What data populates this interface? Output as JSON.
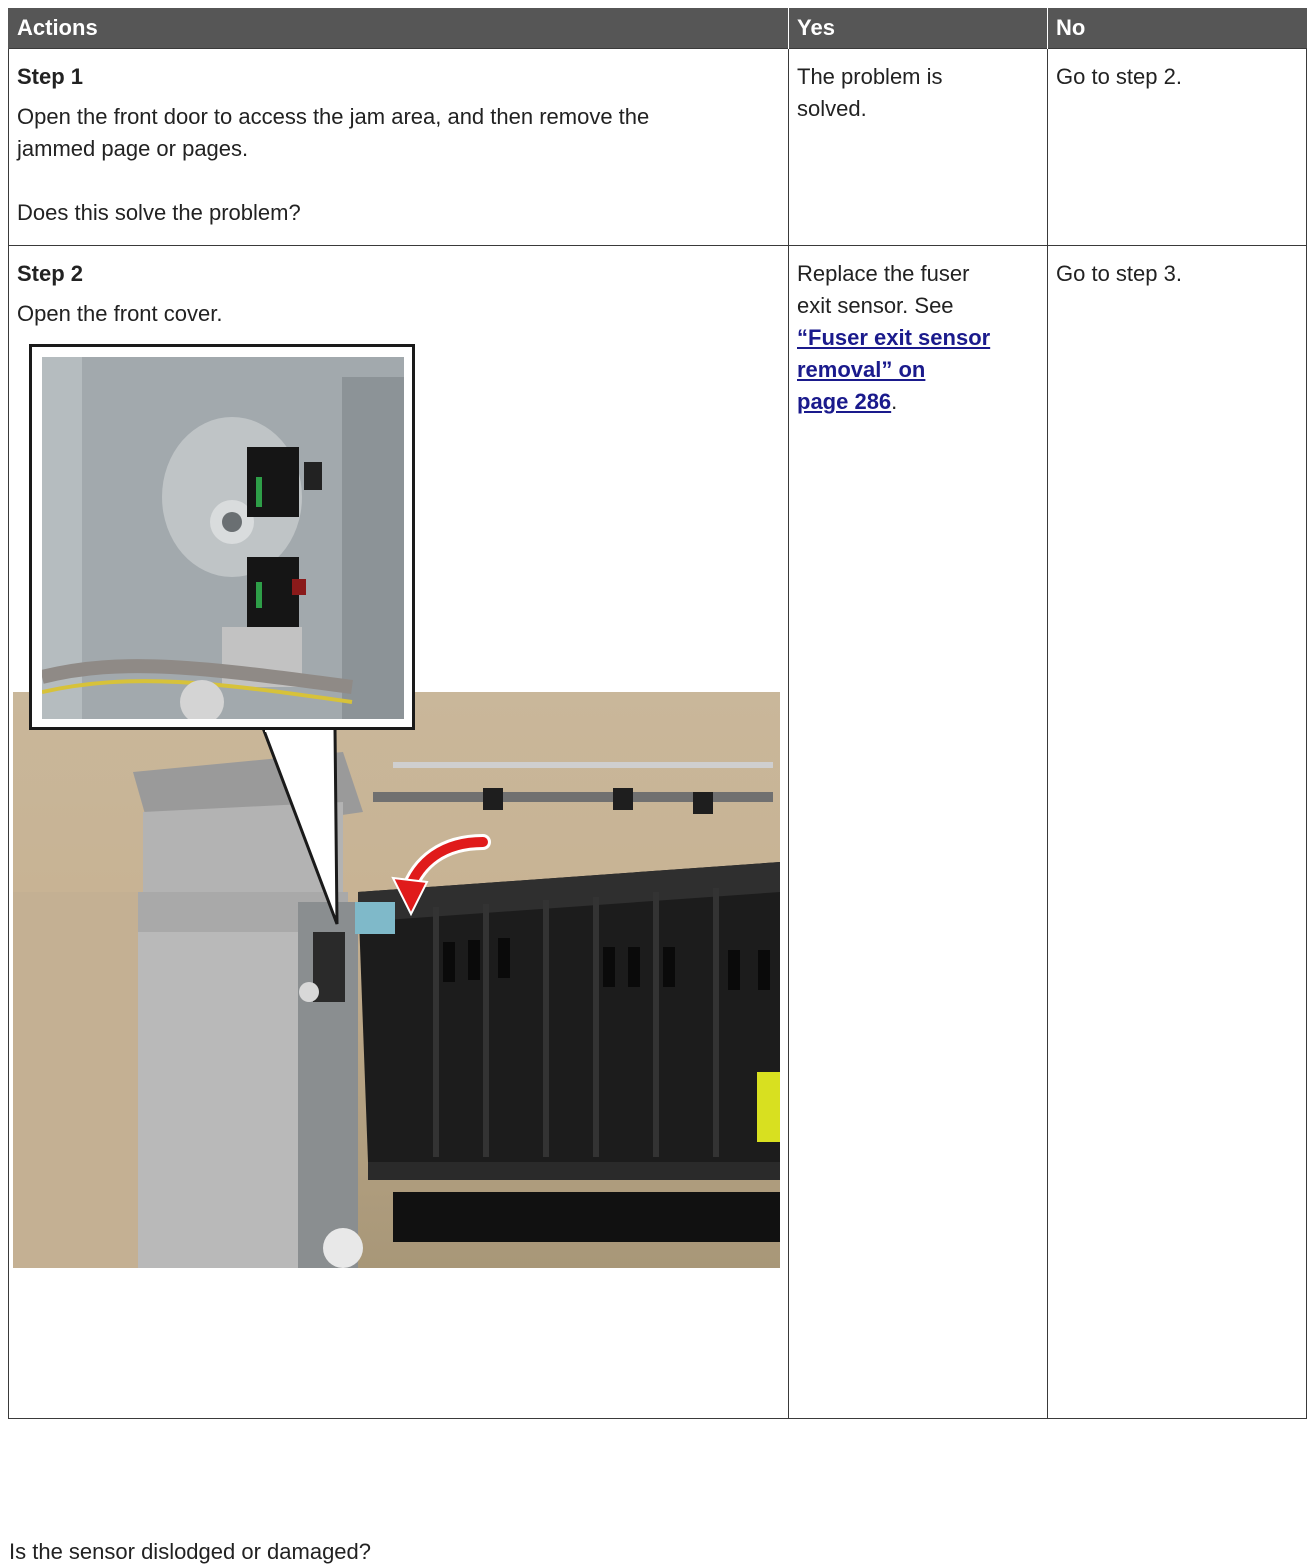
{
  "table": {
    "headers": {
      "actions": "Actions",
      "yes": "Yes",
      "no": "No"
    },
    "rows": [
      {
        "step": "Step 1",
        "lines": [
          "Open the front door to access the jam area, and then remove the",
          "jammed page or pages."
        ],
        "question": "Does this solve the problem?",
        "yes": [
          "The problem is",
          "solved."
        ],
        "no": "Go to step 2."
      },
      {
        "step": "Step 2",
        "instruction": "Open the front cover.",
        "question": "Is the sensor dislodged or damaged?",
        "yes_lines": [
          "Replace the fuser",
          "exit sensor. See"
        ],
        "yes_link": [
          "“Fuser exit sensor",
          "removal” on",
          "page 286"
        ],
        "yes_link_suffix": ".",
        "no": "Go to step 3."
      }
    ]
  },
  "figure": {
    "description_icons": [
      "fuser-exit-sensor-closeup",
      "fuser-unit-photo",
      "rotate-arrow-icon"
    ],
    "colors": {
      "arrow": "#e01b1b",
      "tab": "#7fb9c9",
      "fuser": "#1c1c1c",
      "warning_label": "#d8e020"
    }
  }
}
